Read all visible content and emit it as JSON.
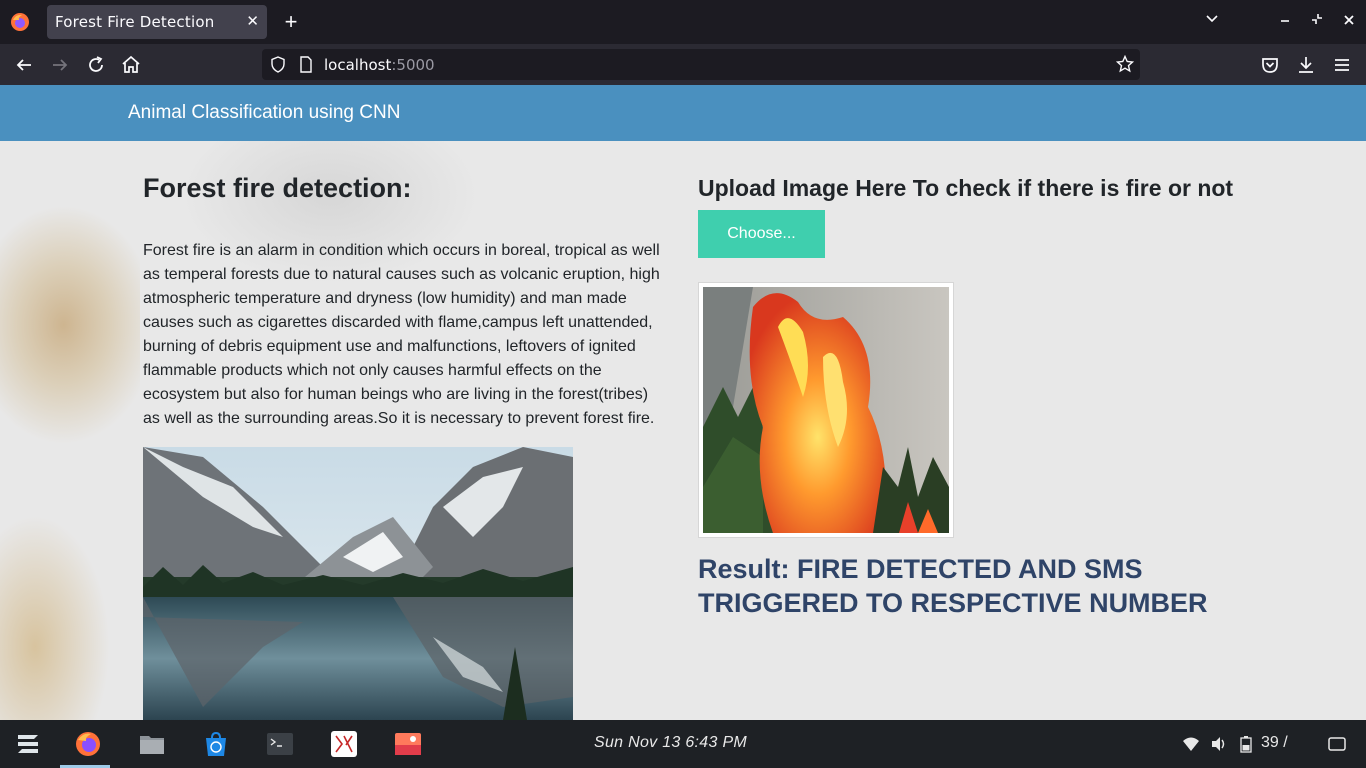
{
  "browser": {
    "tab_title": "Forest Fire Detection",
    "url_host": "localhost",
    "url_port": ":5000"
  },
  "page": {
    "brand": "Animal Classification using CNN",
    "left": {
      "title": "Forest fire detection:",
      "description": "Forest fire is an alarm in condition which occurs in boreal, tropical as well as temperal forests due to natural causes such as volcanic eruption, high atmospheric temperature and dryness (low humidity) and man made causes such as cigarettes discarded with flame,campus left unattended, burning of debris equipment use and malfunctions, leftovers of ignited flammable products which not only causes harmful effects on the ecosystem but also for human beings who are living in the forest(tribes) as well as the surrounding areas.So it is necessary to prevent forest fire."
    },
    "right": {
      "upload_title": "Upload Image Here To check if there is fire or not",
      "choose_label": "Choose...",
      "result_text": "Result: FIRE DETECTED AND SMS TRIGGERED TO RESPECTIVE NUMBER"
    }
  },
  "taskbar": {
    "clock": "Sun Nov 13   6:43 PM",
    "battery": "39 /"
  },
  "colors": {
    "header": "#4a90bf",
    "button": "#3fcfae",
    "result": "#2f4468"
  }
}
